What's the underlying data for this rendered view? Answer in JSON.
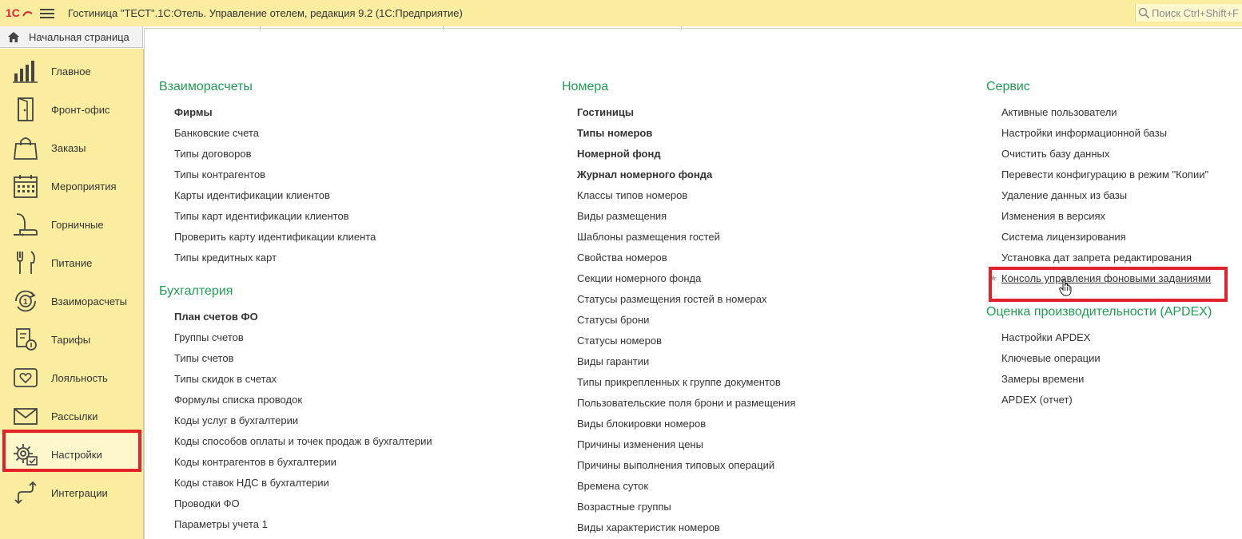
{
  "titlebar": {
    "app_title": "Гостиница \"ТЕСТ\".1С:Отель. Управление отелем, редакция 9.2  (1С:Предприятие)",
    "search_placeholder": "Поиск Ctrl+Shift+F",
    "logo_icon": "1c-logo-icon",
    "menu_icon": "hamburger-menu-icon"
  },
  "tabs": {
    "home_label": "Начальная страница",
    "home_icon": "home-icon"
  },
  "sidebar": {
    "items": [
      {
        "label": "Главное",
        "icon": "bar-chart-icon"
      },
      {
        "label": "Фронт-офис",
        "icon": "door-icon"
      },
      {
        "label": "Заказы",
        "icon": "shopping-bag-icon"
      },
      {
        "label": "Мероприятия",
        "icon": "calendar-icon"
      },
      {
        "label": "Горничные",
        "icon": "vacuum-cleaner-icon"
      },
      {
        "label": "Питание",
        "icon": "fork-knife-icon"
      },
      {
        "label": "Взаиморасчеты",
        "icon": "coin-cycle-icon"
      },
      {
        "label": "Тарифы",
        "icon": "price-document-icon"
      },
      {
        "label": "Лояльность",
        "icon": "heart-card-icon"
      },
      {
        "label": "Рассылки",
        "icon": "envelope-icon"
      },
      {
        "label": "Настройки",
        "icon": "gear-icon"
      },
      {
        "label": "Интеграции",
        "icon": "exchange-arrows-icon"
      }
    ],
    "selected": "Настройки"
  },
  "content": {
    "col1": {
      "sections": [
        {
          "title": "Взаиморасчеты",
          "links": [
            {
              "text": "Фирмы",
              "bold": true
            },
            {
              "text": "Банковские счета"
            },
            {
              "text": "Типы договоров"
            },
            {
              "text": "Типы контрагентов"
            },
            {
              "text": "Карты идентификации клиентов"
            },
            {
              "text": "Типы карт идентификации клиентов"
            },
            {
              "text": "Проверить карту идентификации клиента"
            },
            {
              "text": "Типы кредитных карт"
            }
          ]
        },
        {
          "title": "Бухгалтерия",
          "links": [
            {
              "text": "План счетов ФО",
              "bold": true
            },
            {
              "text": "Группы счетов"
            },
            {
              "text": "Типы счетов"
            },
            {
              "text": "Типы скидок в счетах"
            },
            {
              "text": "Формулы списка проводок"
            },
            {
              "text": "Коды услуг в бухгалтерии"
            },
            {
              "text": "Коды способов оплаты и точек продаж в бухгалтерии"
            },
            {
              "text": "Коды контрагентов в бухгалтерии"
            },
            {
              "text": "Коды ставок НДС в бухгалтерии"
            },
            {
              "text": "Проводки ФО"
            },
            {
              "text": "Параметры учета 1"
            }
          ]
        }
      ]
    },
    "col2": {
      "sections": [
        {
          "title": "Номера",
          "links": [
            {
              "text": "Гостиницы",
              "bold": true
            },
            {
              "text": "Типы номеров",
              "bold": true
            },
            {
              "text": "Номерной фонд",
              "bold": true
            },
            {
              "text": "Журнал номерного фонда",
              "bold": true
            },
            {
              "text": "Классы типов номеров"
            },
            {
              "text": "Виды размещения"
            },
            {
              "text": "Шаблоны размещения гостей"
            },
            {
              "text": "Свойства номеров"
            },
            {
              "text": "Секции номерного фонда"
            },
            {
              "text": "Статусы размещения гостей в номерах"
            },
            {
              "text": "Статусы брони"
            },
            {
              "text": "Статусы номеров"
            },
            {
              "text": "Виды гарантии"
            },
            {
              "text": "Типы прикрепленных к группе документов"
            },
            {
              "text": "Пользовательские поля брони и размещения"
            },
            {
              "text": "Виды блокировки номеров"
            },
            {
              "text": "Причины изменения цены"
            },
            {
              "text": "Причины выполнения типовых операций"
            },
            {
              "text": "Времена суток"
            },
            {
              "text": "Возрастные группы"
            },
            {
              "text": "Виды характеристик номеров"
            }
          ]
        }
      ]
    },
    "col3": {
      "sections": [
        {
          "title": "Сервис",
          "links": [
            {
              "text": "Активные пользователи"
            },
            {
              "text": "Настройки информационной базы"
            },
            {
              "text": "Очистить базу данных"
            },
            {
              "text": "Перевести конфигурацию в режим \"Копии\""
            },
            {
              "text": "Удаление данных из базы"
            },
            {
              "text": "Изменения в версиях"
            },
            {
              "text": "Система лицензирования"
            },
            {
              "text": "Установка дат запрета редактирования"
            },
            {
              "text": "Консоль управления фоновыми заданиями",
              "hovered": true
            }
          ]
        },
        {
          "title": "Оценка производительности (APDEX)",
          "links": [
            {
              "text": "Настройки APDEX"
            },
            {
              "text": "Ключевые операции"
            },
            {
              "text": "Замеры времени"
            },
            {
              "text": "APDEX (отчет)"
            }
          ]
        }
      ]
    }
  },
  "colors": {
    "panel_yellow": "#fbeda0",
    "section_green": "#1f9d55",
    "highlight_red": "#e3232c",
    "text": "#333333"
  }
}
